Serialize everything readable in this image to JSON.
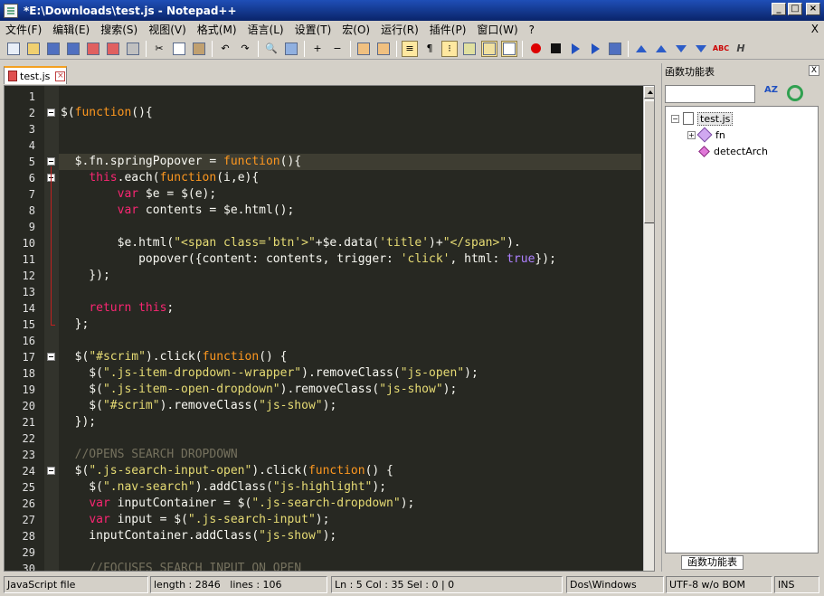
{
  "window": {
    "title": "*E:\\Downloads\\test.js - Notepad++"
  },
  "menu": [
    "文件(F)",
    "编辑(E)",
    "搜索(S)",
    "视图(V)",
    "格式(M)",
    "语言(L)",
    "设置(T)",
    "宏(O)",
    "运行(R)",
    "插件(P)",
    "窗口(W)",
    "?"
  ],
  "menu_close": "X",
  "tab": {
    "label": "test.js"
  },
  "code_lines": [
    {
      "n": "1",
      "html": ""
    },
    {
      "n": "2",
      "html": "$(<span class='f'>function</span>(){"
    },
    {
      "n": "3",
      "html": ""
    },
    {
      "n": "4",
      "html": ""
    },
    {
      "n": "5",
      "html": "  $.fn.springPopover = <span class='f'>function</span>(){"
    },
    {
      "n": "6",
      "html": "    <span class='k'>this</span>.each(<span class='f'>function</span>(i,e){"
    },
    {
      "n": "7",
      "html": "        <span class='k'>var</span> $e = $(e);"
    },
    {
      "n": "8",
      "html": "        <span class='k'>var</span> contents = $e.html();"
    },
    {
      "n": "9",
      "html": ""
    },
    {
      "n": "10",
      "html": "        $e.html(<span class='s'>\"&lt;span class='btn'&gt;\"</span>+$e.data(<span class='s'>'title'</span>)+<span class='s'>\"&lt;/span&gt;\"</span>)."
    },
    {
      "n": "11",
      "html": "           popover({content: contents, trigger: <span class='s'>'click'</span>, html: <span class='t'>true</span>});"
    },
    {
      "n": "12",
      "html": "    });"
    },
    {
      "n": "13",
      "html": ""
    },
    {
      "n": "14",
      "html": "    <span class='k'>return</span> <span class='k'>this</span>;"
    },
    {
      "n": "15",
      "html": "  };"
    },
    {
      "n": "16",
      "html": ""
    },
    {
      "n": "17",
      "html": "  $(<span class='s'>\"#scrim\"</span>).click(<span class='f'>function</span>() {"
    },
    {
      "n": "18",
      "html": "    $(<span class='s'>\".js-item-dropdown--wrapper\"</span>).removeClass(<span class='s'>\"js-open\"</span>);"
    },
    {
      "n": "19",
      "html": "    $(<span class='s'>\".js-item--open-dropdown\"</span>).removeClass(<span class='s'>\"js-show\"</span>);"
    },
    {
      "n": "20",
      "html": "    $(<span class='s'>\"#scrim\"</span>).removeClass(<span class='s'>\"js-show\"</span>);"
    },
    {
      "n": "21",
      "html": "  });"
    },
    {
      "n": "22",
      "html": ""
    },
    {
      "n": "23",
      "html": "  <span class='c'>//OPENS SEARCH DROPDOWN</span>"
    },
    {
      "n": "24",
      "html": "  $(<span class='s'>\".js-search-input-open\"</span>).click(<span class='f'>function</span>() {"
    },
    {
      "n": "25",
      "html": "    $(<span class='s'>\".nav-search\"</span>).addClass(<span class='s'>\"js-highlight\"</span>);"
    },
    {
      "n": "26",
      "html": "    <span class='k'>var</span> inputContainer = $(<span class='s'>\".js-search-dropdown\"</span>);"
    },
    {
      "n": "27",
      "html": "    <span class='k'>var</span> input = $(<span class='s'>\".js-search-input\"</span>);"
    },
    {
      "n": "28",
      "html": "    inputContainer.addClass(<span class='s'>\"js-show\"</span>);"
    },
    {
      "n": "29",
      "html": ""
    },
    {
      "n": "30",
      "html": "    <span class='c'>//FOCUSES SEARCH INPUT ON OPEN</span>"
    }
  ],
  "function_list": {
    "title": "函数功能表",
    "close": "X",
    "sort_label": "AZ",
    "tree": {
      "file": "test.js",
      "class": "fn",
      "method": "detectArch"
    },
    "bottom_tab": "函数功能表"
  },
  "status": {
    "lang": "JavaScript file",
    "length": "length : 2846",
    "lines": "lines : 106",
    "pos": "Ln : 5    Col : 35    Sel : 0 | 0",
    "eol": "Dos\\Windows",
    "enc": "UTF-8 w/o BOM",
    "mode": "INS"
  }
}
